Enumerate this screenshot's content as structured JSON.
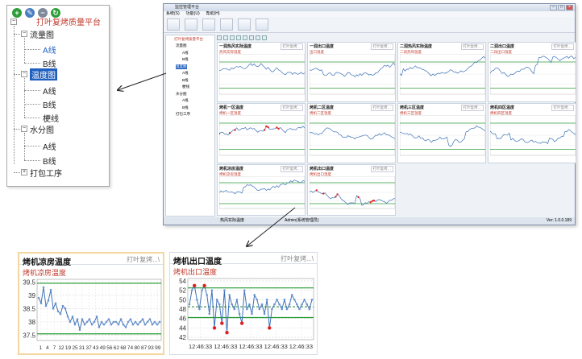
{
  "tree": {
    "toolbar": [
      {
        "icon": "add-icon",
        "color": "#2e9e3a"
      },
      {
        "icon": "edit-icon",
        "color": "#4a7fc1"
      },
      {
        "icon": "remove-icon",
        "color": "#7d8a99"
      },
      {
        "icon": "refresh-icon",
        "color": "#2e9e3a"
      }
    ],
    "root": "打叶复烤质量平台",
    "groups": [
      {
        "label": "流量图",
        "children": [
          "A线",
          "B线"
        ]
      },
      {
        "label": "温度图",
        "children": [
          "A线",
          "B线",
          "梗线"
        ]
      },
      {
        "label": "水分图",
        "children": [
          "A线",
          "B线"
        ]
      }
    ],
    "tail": "打包工序"
  },
  "app": {
    "title": "监控管理平台",
    "menu": [
      "系统(S)",
      "功能(U)",
      "帮助(H)"
    ],
    "mini_tree": {
      "root": "打叶复烤质量平台",
      "items": [
        "流量图",
        "A线",
        "B线",
        "温度图",
        "A线",
        "B线",
        "梗线",
        "水分图",
        "A线",
        "B线",
        "打包工序"
      ]
    },
    "panels": [
      {
        "title": "一润热风实际温度",
        "tag": "打叶复烤…",
        "sub": "热风实际温度"
      },
      {
        "title": "一润出口温度",
        "tag": "打叶复烤…",
        "sub": "出口温度"
      },
      {
        "title": "二润热风实际温度",
        "tag": "打叶复烤…",
        "sub": "二润热风温度"
      },
      {
        "title": "二润出口温度",
        "tag": "打叶复烤…",
        "sub": "二润出口温度"
      },
      {
        "title": "烤机一区温度",
        "tag": "打叶复烤…",
        "sub": "烤机一区温度"
      },
      {
        "title": "烤机二区温度",
        "tag": "打叶复烤…",
        "sub": "烤机二区温度"
      },
      {
        "title": "烤机三区温度",
        "tag": "打叶复烤…",
        "sub": "烤机三区温度"
      },
      {
        "title": "烤机四区温度",
        "tag": "打叶复烤…",
        "sub": "烤机四区温度"
      },
      {
        "title": "烤机凉房温度",
        "tag": "打叶复烤…",
        "sub": "烤机凉房温度"
      },
      {
        "title": "烤机出口温度",
        "tag": "打叶复烤…",
        "sub": "烤机出口温度"
      }
    ],
    "status": {
      "left": "热风实际温度",
      "mid": "Admin(系统管理员)",
      "right": "Ver: 1.0.0.189"
    }
  },
  "zoom_left": {
    "title": "烤机凉房温度",
    "tag": "打叶复烤...\\",
    "sub": "烤机凉房温度",
    "chart_data": {
      "type": "line",
      "y_ticks": [
        "39.5",
        "39",
        "38.5",
        "38",
        "37.5"
      ],
      "ylim": [
        37.3,
        39.6
      ],
      "x_ticks": [
        "1",
        "4",
        "7",
        "12",
        "19",
        "25",
        "31",
        "37",
        "43",
        "49",
        "56",
        "62",
        "68",
        "74",
        "80",
        "87",
        "93",
        "99"
      ],
      "limit_lines": [
        39.45,
        37.55
      ],
      "values": [
        38.9,
        38.7,
        39.3,
        38.6,
        38.8,
        39.2,
        38.5,
        38.7,
        38.4,
        38.3,
        38.6,
        38.5,
        38.2,
        38.0,
        38.2,
        37.9,
        38.1,
        37.7,
        38.1,
        37.9,
        38.0,
        38.1,
        37.9,
        38.0,
        38.2,
        37.8,
        38.0,
        37.9,
        38.0,
        38.1,
        37.9,
        38.0,
        38.0,
        37.9,
        38.1,
        37.9,
        37.8,
        38.0,
        38.1,
        37.9,
        38.0,
        37.9,
        38.0,
        38.1,
        37.9,
        38.0,
        38.1,
        37.9,
        38.0,
        37.9,
        38.0
      ]
    }
  },
  "zoom_right": {
    "title": "烤机出口温度",
    "tag": "打叶复烤...\\",
    "sub": "烤机出口温度",
    "chart_data": {
      "type": "line",
      "y_ticks": [
        "54",
        "52",
        "50",
        "48",
        "46",
        "44",
        "42"
      ],
      "ylim": [
        41.5,
        54.5
      ],
      "x_ticks": [
        "12:46:33",
        "12:46:33",
        "12:46:33",
        "12:46:33",
        "12:46:33"
      ],
      "limit_lines": [
        52.5,
        46.2
      ],
      "center_line": 48.5,
      "values": [
        49,
        52,
        53,
        50,
        48,
        52,
        53,
        51,
        47,
        52,
        44,
        50,
        49,
        45,
        52,
        43,
        51,
        49,
        48,
        50,
        47,
        45,
        52,
        48,
        49,
        47,
        51,
        50,
        48,
        49,
        47,
        50,
        44,
        48,
        49,
        50,
        49,
        48,
        50,
        48,
        49,
        51,
        50,
        49,
        48,
        49,
        50,
        49,
        48,
        50
      ]
    }
  }
}
